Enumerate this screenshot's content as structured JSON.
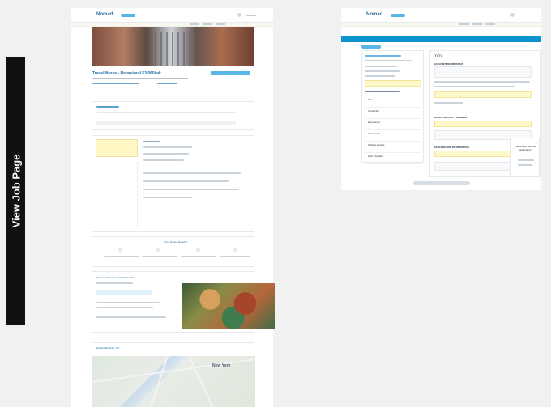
{
  "side_label": "View Job Page",
  "left": {
    "brand": "Nomad",
    "job_title": "Travel Nurse - Behavioral $3,080/wk",
    "apply_button": "",
    "section_titles": [
      "Your Nurses Benefits",
      "NYC Health and Hospitals/Woodhull",
      "Explore Brooklyn, NY"
    ],
    "map_label": "New York"
  },
  "right": {
    "brand": "Nomad",
    "panel_title": "Info",
    "sections": [
      "ACCOUNT INFORMATION",
      "SOCIAL SECURITY NUMBER",
      "BACKGROUND INFORMATION"
    ],
    "steps": [
      "Info",
      "Credential",
      "Experience",
      "Documents",
      "Starting Details",
      "Web Checklist"
    ],
    "chat_prompt": "Need help with this application?"
  }
}
